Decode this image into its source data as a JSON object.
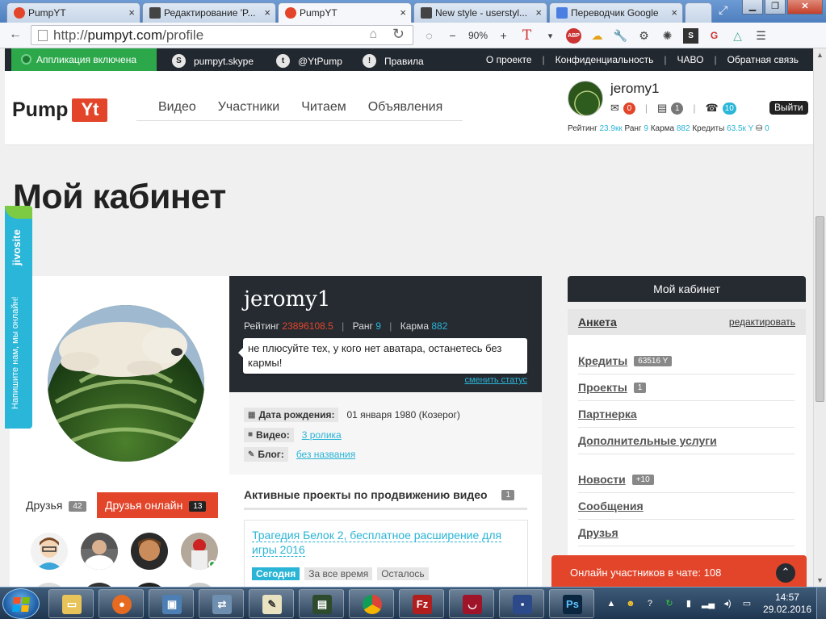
{
  "browser": {
    "tabs": [
      {
        "title": "PumpYT",
        "favicon_color": "#e2452a",
        "active": false
      },
      {
        "title": "Редактирование 'P...",
        "favicon_color": "#444444",
        "active": false
      },
      {
        "title": "PumpYT",
        "favicon_color": "#e2452a",
        "active": true
      },
      {
        "title": "New style - userstyl...",
        "favicon_color": "#444444",
        "active": false
      },
      {
        "title": "Переводчик Google",
        "favicon_color": "#4a7ee0",
        "active": false
      }
    ],
    "url_scheme": "http://",
    "url_host": "pumpyt.com",
    "url_path": "/profile",
    "zoom": "90%",
    "toolbar_icons": [
      "loading-icon",
      "zoom-out-icon",
      "zoom-in-icon",
      "translate-icon",
      "style-icon",
      "adblock-icon",
      "weather-icon",
      "wrench-icon",
      "gear-icon",
      "settings-icon",
      "stylish-icon",
      "gmail-icon",
      "drive-icon"
    ]
  },
  "site": {
    "topbar": {
      "app_status": "Аппликация включена",
      "skype": "pumpyt.skype",
      "twitter": "@YtPump",
      "rules": "Правила",
      "links": [
        "О проекте",
        "Конфиденциальность",
        "ЧАВО",
        "Обратная связь"
      ]
    },
    "logo": {
      "pump": "Pump",
      "yt": "Yt"
    },
    "nav": [
      "Видео",
      "Участники",
      "Читаем",
      "Объявления"
    ],
    "user": {
      "name": "jeromy1",
      "messages": "0",
      "docs": "1",
      "notifications": "10",
      "logout": "Выйти",
      "stats": {
        "rating_label": "Рейтинг",
        "rating": "23.9кк",
        "rank_label": "Ранг",
        "rank": "9",
        "karma_label": "Карма",
        "karma": "882",
        "credits_label": "Кредиты",
        "credits": "63.5к Y",
        "coins": "0"
      }
    },
    "page_title": "Мой кабинет",
    "jivo": {
      "brand": "jivosite",
      "text": "Напишите нам, мы онлайн!"
    },
    "profile": {
      "name": "jeromy1",
      "rating_label": "Рейтинг",
      "rating": "23896108.5",
      "rank_label": "Ранг",
      "rank": "9",
      "karma_label": "Карма",
      "karma": "882",
      "status": "не плюсуйте тех, у кого нет аватара, останетесь без кармы!",
      "change_status": "сменить статус",
      "birthday_label": "Дата рождения:",
      "birthday": "01 января 1980 (Козерог)",
      "video_label": "Видео:",
      "video": "3 ролика",
      "blog_label": "Блог:",
      "blog": "без названия"
    },
    "friends": {
      "tab_friends": "Друзья",
      "friends_count": "42",
      "tab_online": "Друзья онлайн",
      "online_count": "13"
    },
    "projects": {
      "title": "Активные проекты по продвижению видео",
      "count": "1",
      "item_title": "Трагедия Белок 2, бесплатное расширение для игры 2016",
      "filters": [
        "Сегодня",
        "За все время",
        "Осталось"
      ]
    },
    "sidebar": {
      "head": "Мой кабинет",
      "anketa": "Анкета",
      "edit": "редактировать",
      "items": [
        {
          "label": "Кредиты",
          "count": "63516 Y"
        },
        {
          "label": "Проекты",
          "count": "1"
        },
        {
          "label": "Партнерка",
          "count": ""
        },
        {
          "label": "Дополнительные услуги",
          "count": ""
        },
        {
          "label": "Новости",
          "count": "+10"
        },
        {
          "label": "Сообщения",
          "count": ""
        },
        {
          "label": "Друзья",
          "count": ""
        }
      ]
    },
    "chat": {
      "text": "Онлайн участников в чате: 108"
    }
  },
  "taskbar": {
    "apps": [
      "explorer",
      "firefox",
      "computer",
      "network",
      "notepad",
      "terminal",
      "chrome",
      "filezilla",
      "wine",
      "save",
      "photoshop"
    ],
    "time": "14:57",
    "date": "29.02.2016"
  },
  "colors": {
    "accent_red": "#e2452a",
    "accent_cyan": "#2ab4d6",
    "dark": "#262b32",
    "green": "#2ca84b"
  }
}
